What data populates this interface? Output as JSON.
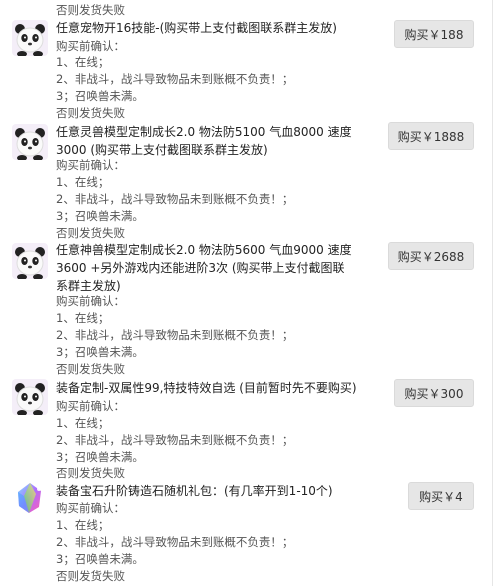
{
  "top_fail_note": "否则发货失败",
  "items": [
    {
      "icon": "panda-icon",
      "title": "任意宠物开16技能-(购买带上支付截图联系群主发放)",
      "buy_label": "购买￥188",
      "confirm_head": "购买前确认：",
      "c1": "1、在线；",
      "c2": "2、非战斗，战斗导致物品未到账概不负责！；",
      "c3": "3；召唤兽未满。",
      "fail": "否则发货失败"
    },
    {
      "icon": "panda-icon",
      "title": "任意灵兽模型定制成长2.0 物法防5100 气血8000 速度3000 (购买带上支付截图联系群主发放)",
      "buy_label": "购买￥1888",
      "confirm_head": "购买前确认：",
      "c1": "1、在线；",
      "c2": "2、非战斗，战斗导致物品未到账概不负责！；",
      "c3": "3；召唤兽未满。",
      "fail": "否则发货失败"
    },
    {
      "icon": "panda-icon",
      "title": "任意神兽模型定制成长2.0 物法防5600 气血9000 速度3600 +另外游戏内还能进阶3次 (购买带上支付截图联系群主发放)",
      "buy_label": "购买￥2688",
      "confirm_head": "购买前确认：",
      "c1": "1、在线；",
      "c2": "2、非战斗，战斗导致物品未到账概不负责！；",
      "c3": "3；召唤兽未满。",
      "fail": "否则发货失败"
    },
    {
      "icon": "panda-icon",
      "title": "装备定制-双属性99,特技特效自选 (目前暂时先不要购买)",
      "buy_label": "购买￥300",
      "confirm_head": "购买前确认：",
      "c1": "1、在线；",
      "c2": "2、非战斗，战斗导致物品未到账概不负责！；",
      "c3": "3；召唤兽未满。",
      "fail": "否则发货失败"
    },
    {
      "icon": "crystal-gem-icon",
      "title": "装备宝石升阶铸造石随机礼包：(有几率开到1-10个)",
      "buy_label": "购买￥4",
      "confirm_head": "购买前确认：",
      "c1": "1、在线；",
      "c2": "2、非战斗，战斗导致物品未到账概不负责！；",
      "c3": "3；召唤兽未满。",
      "fail": "否则发货失败"
    }
  ],
  "colors": {
    "button_bg": "#e6e6e6",
    "text": "#333333",
    "muted": "#555555"
  }
}
